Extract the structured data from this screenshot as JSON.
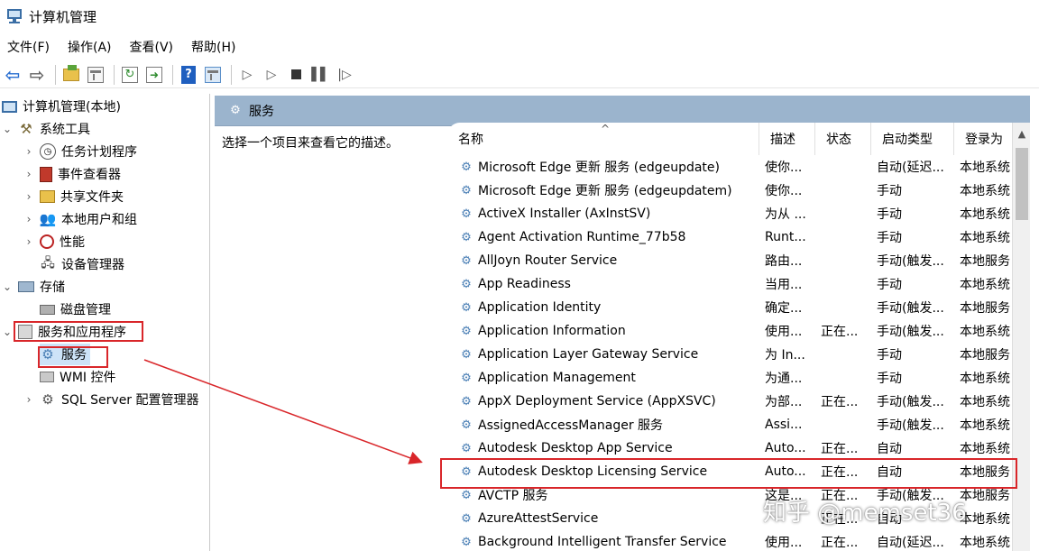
{
  "window": {
    "title": "计算机管理"
  },
  "menu": [
    "文件(F)",
    "操作(A)",
    "查看(V)",
    "帮助(H)"
  ],
  "tree": {
    "root": "计算机管理(本地)",
    "system_tools": "系统工具",
    "task_scheduler": "任务计划程序",
    "event_viewer": "事件查看器",
    "shared_folders": "共享文件夹",
    "local_users": "本地用户和组",
    "performance": "性能",
    "device_manager": "设备管理器",
    "storage": "存储",
    "disk_mgmt": "磁盘管理",
    "services_apps": "服务和应用程序",
    "services": "服务",
    "wmi": "WMI 控件",
    "sql": "SQL Server 配置管理器"
  },
  "panel": {
    "header": "服务",
    "description_prompt": "选择一个项目来查看它的描述。"
  },
  "columns": {
    "name": "名称",
    "desc": "描述",
    "status": "状态",
    "startup": "启动类型",
    "logon": "登录为"
  },
  "rows": [
    {
      "name": "Microsoft Edge 更新 服务 (edgeupdate)",
      "desc": "使你...",
      "status": "",
      "startup": "自动(延迟...",
      "logon": "本地系统"
    },
    {
      "name": "Microsoft Edge 更新 服务 (edgeupdatem)",
      "desc": "使你...",
      "status": "",
      "startup": "手动",
      "logon": "本地系统"
    },
    {
      "name": "ActiveX Installer (AxInstSV)",
      "desc": "为从 ...",
      "status": "",
      "startup": "手动",
      "logon": "本地系统"
    },
    {
      "name": "Agent Activation Runtime_77b58",
      "desc": "Runt...",
      "status": "",
      "startup": "手动",
      "logon": "本地系统"
    },
    {
      "name": "AllJoyn Router Service",
      "desc": "路由...",
      "status": "",
      "startup": "手动(触发...",
      "logon": "本地服务"
    },
    {
      "name": "App Readiness",
      "desc": "当用...",
      "status": "",
      "startup": "手动",
      "logon": "本地系统"
    },
    {
      "name": "Application Identity",
      "desc": "确定...",
      "status": "",
      "startup": "手动(触发...",
      "logon": "本地服务"
    },
    {
      "name": "Application Information",
      "desc": "使用...",
      "status": "正在...",
      "startup": "手动(触发...",
      "logon": "本地系统"
    },
    {
      "name": "Application Layer Gateway Service",
      "desc": "为 In...",
      "status": "",
      "startup": "手动",
      "logon": "本地服务"
    },
    {
      "name": "Application Management",
      "desc": "为通...",
      "status": "",
      "startup": "手动",
      "logon": "本地系统"
    },
    {
      "name": "AppX Deployment Service (AppXSVC)",
      "desc": "为部...",
      "status": "正在...",
      "startup": "手动(触发...",
      "logon": "本地系统"
    },
    {
      "name": "AssignedAccessManager 服务",
      "desc": "Assi...",
      "status": "",
      "startup": "手动(触发...",
      "logon": "本地系统"
    },
    {
      "name": "Autodesk Desktop App Service",
      "desc": "Auto...",
      "status": "正在...",
      "startup": "自动",
      "logon": "本地系统"
    },
    {
      "name": "Autodesk Desktop Licensing Service",
      "desc": "Auto...",
      "status": "正在...",
      "startup": "自动",
      "logon": "本地服务"
    },
    {
      "name": "AVCTP 服务",
      "desc": "这是...",
      "status": "正在...",
      "startup": "手动(触发...",
      "logon": "本地服务"
    },
    {
      "name": "AzureAttestService",
      "desc": "",
      "status": "正在...",
      "startup": "自动",
      "logon": "本地系统"
    },
    {
      "name": "Background Intelligent Transfer Service",
      "desc": "使用...",
      "status": "正在...",
      "startup": "自动(延迟...",
      "logon": "本地系统"
    }
  ],
  "watermark": "知乎 @memset36"
}
